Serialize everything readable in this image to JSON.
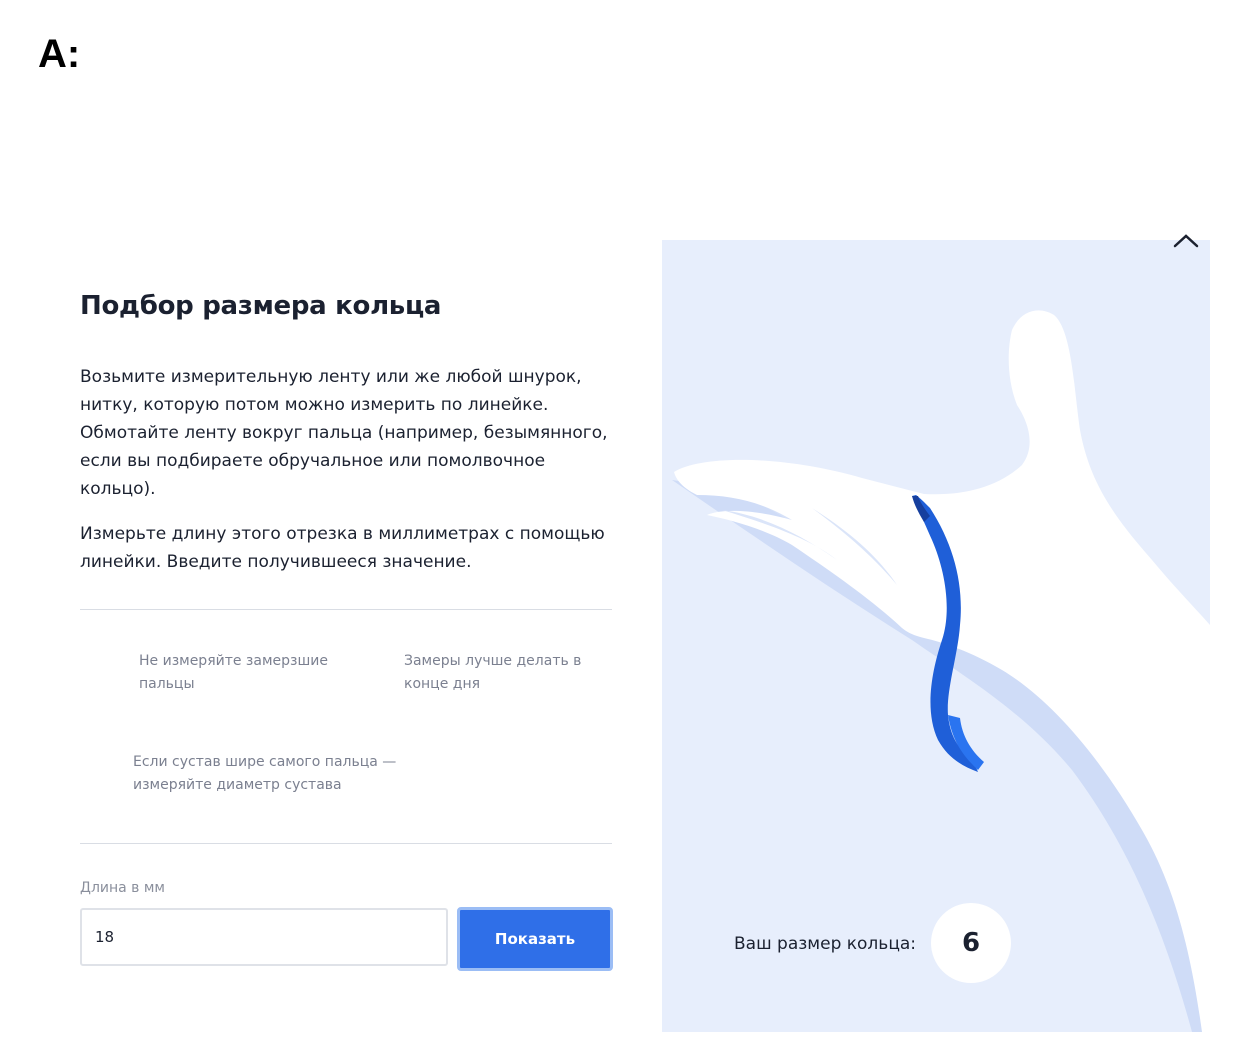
{
  "header_label": "A:",
  "modal": {
    "title": "Подбор размера кольца",
    "paragraph1": "Возьмите измерительную ленту или же любой шнурок, нитку, которую потом можно измерить по линейке. Обмотайте ленту вокруг пальца (например, безымянного, если вы подбираете обручальное или помолвочное кольцо).",
    "paragraph2": "Измерьте длину этого отрезка в миллиметрах с помощью линейки. Введите получившееся значение.",
    "tips": [
      "Не измеряйте замерзшие пальцы",
      "Замеры лучше делать в конце дня",
      "Если сустав шире самого пальца — измеряйте диаметр сустава"
    ],
    "field_label": "Длина в мм",
    "input_value": "18",
    "button_label": "Показать"
  },
  "result": {
    "label": "Ваш размер кольца:",
    "value": "6"
  },
  "icons": {
    "close": "close-icon"
  },
  "colors": {
    "accent": "#2f6fe8",
    "panel_background": "#e7eefc",
    "ribbon": "#1f5fd8"
  }
}
